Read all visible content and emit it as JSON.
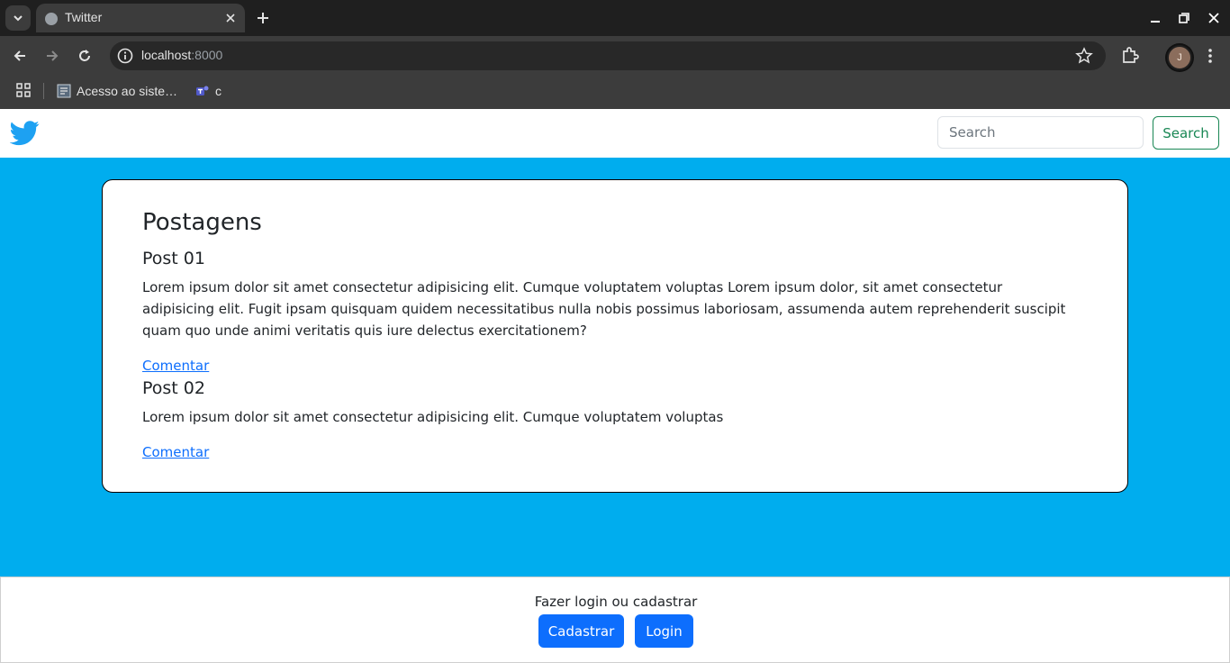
{
  "browser": {
    "tab_title": "Twitter",
    "url_host": "localhost",
    "url_port": ":8000",
    "avatar_initial": "J",
    "bookmarks": [
      {
        "label": "Acesso ao siste…",
        "icon": "document-icon"
      },
      {
        "label": "c",
        "icon": "teams-icon"
      }
    ]
  },
  "navbar": {
    "logo": "twitter-bird-icon",
    "search_placeholder": "Search",
    "search_button": "Search"
  },
  "feed": {
    "title": "Postagens",
    "posts": [
      {
        "title": "Post 01",
        "body": "Lorem ipsum dolor sit amet consectetur adipisicing elit. Cumque voluptatem voluptas Lorem ipsum dolor, sit amet consectetur adipisicing elit. Fugit ipsam quisquam quidem necessitatibus nulla nobis possimus laboriosam, assumenda autem reprehenderit suscipit quam quo unde animi veritatis quis iure delectus exercitationem?",
        "link": "Comentar"
      },
      {
        "title": "Post 02",
        "body": "Lorem ipsum dolor sit amet consectetur adipisicing elit. Cumque voluptatem voluptas",
        "link": "Comentar"
      }
    ]
  },
  "footer": {
    "text": "Fazer login ou cadastrar",
    "register_button": "Cadastrar",
    "login_button": "Login"
  },
  "colors": {
    "background": "#00adee",
    "primary": "#0d6efd",
    "success": "#198754",
    "twitter_blue": "#1da1f2"
  }
}
